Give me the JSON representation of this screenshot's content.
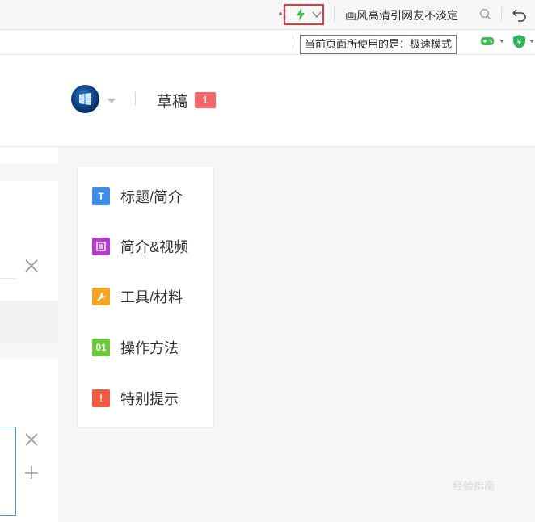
{
  "browser": {
    "search_text": "画风高清引网友不淡定",
    "tooltip": "当前页面所使用的是：极速模式",
    "speed_mode_icon": "lightning-bolt-icon",
    "accent": "#e03a3a"
  },
  "header": {
    "drafts_label": "草稿",
    "drafts_count": "1",
    "badge_color": "#f56565"
  },
  "nav": {
    "items": [
      {
        "label": "标题/简介",
        "icon_text": "T",
        "icon": "title-icon",
        "color": "#3d8de6"
      },
      {
        "label": "简介&视频",
        "icon_text": "≡",
        "icon": "document-icon",
        "color": "#b43ad0"
      },
      {
        "label": "工具/材料",
        "icon_text": "🔧",
        "icon": "wrench-icon",
        "color": "#f4a623"
      },
      {
        "label": "操作方法",
        "icon_text": "01",
        "icon": "steps-icon",
        "color": "#6cc83a"
      },
      {
        "label": "特别提示",
        "icon_text": "!",
        "icon": "warning-icon",
        "color": "#f05a40"
      }
    ]
  },
  "watermark": "经验指南"
}
